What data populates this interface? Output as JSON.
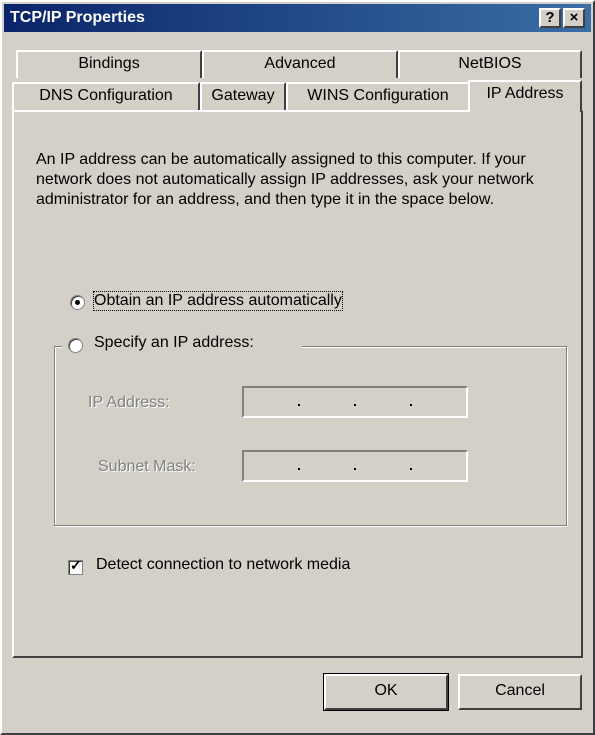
{
  "window": {
    "title": "TCP/IP Properties"
  },
  "titlebar": {
    "help_label": "?",
    "close_label": "×"
  },
  "tabs_row1": [
    {
      "label": "Bindings"
    },
    {
      "label": "Advanced"
    },
    {
      "label": "NetBIOS"
    }
  ],
  "tabs_row2": [
    {
      "label": "DNS Configuration"
    },
    {
      "label": "Gateway"
    },
    {
      "label": "WINS Configuration"
    },
    {
      "label": "IP Address",
      "active": true
    }
  ],
  "description": "An IP address can be automatically assigned to this computer. If your network does not automatically assign IP addresses, ask your network administrator for an address, and then type it in the space below.",
  "options": {
    "obtain_auto": {
      "label": "Obtain an IP address automatically",
      "selected": true
    },
    "specify": {
      "label": "Specify an IP address:",
      "selected": false
    }
  },
  "fields": {
    "ip_address": {
      "label": "IP Address:",
      "value": ""
    },
    "subnet_mask": {
      "label": "Subnet Mask:",
      "value": ""
    }
  },
  "detect": {
    "label": "Detect connection to network media",
    "checked": true
  },
  "buttons": {
    "ok": "OK",
    "cancel": "Cancel"
  }
}
